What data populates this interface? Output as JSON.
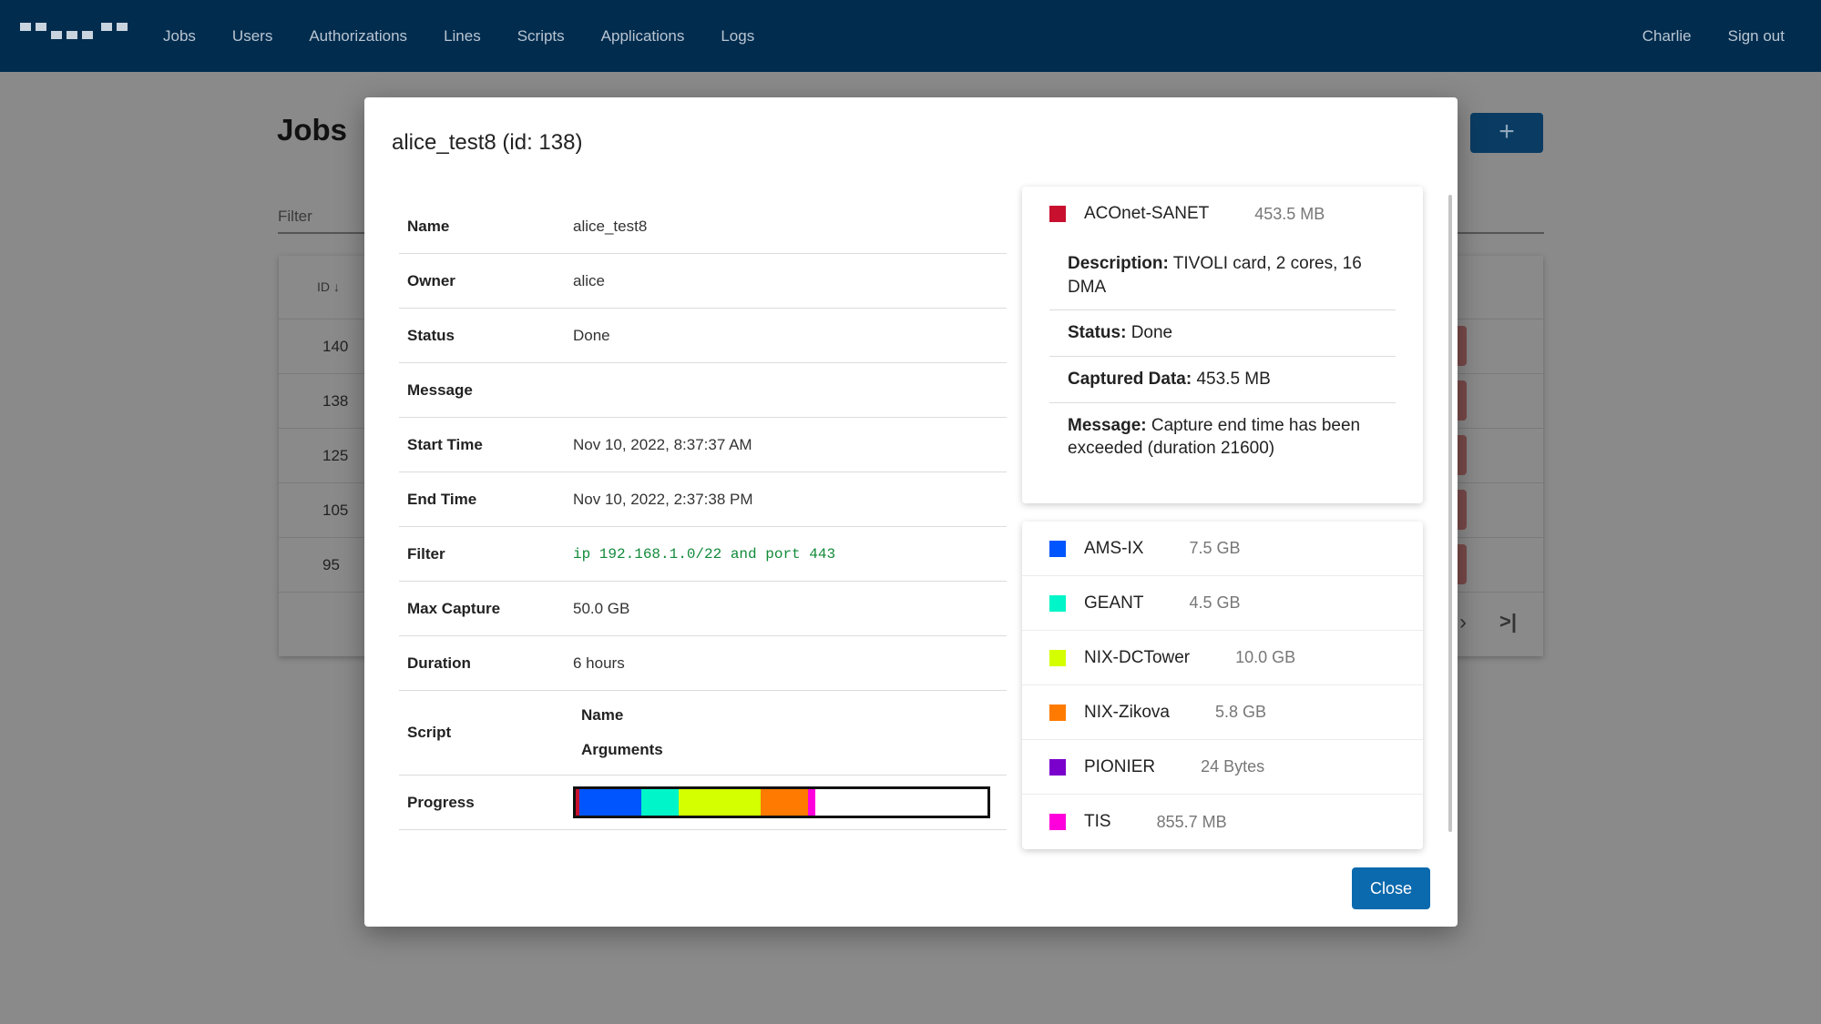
{
  "nav": {
    "items": [
      "Jobs",
      "Users",
      "Authorizations",
      "Lines",
      "Scripts",
      "Applications",
      "Logs"
    ],
    "user": "Charlie",
    "signout": "Sign out"
  },
  "page": {
    "title": "Jobs",
    "add_label": "+",
    "filter_label": "Filter",
    "id_header": "ID ↓",
    "rows": [
      "140",
      "138",
      "125",
      "105",
      "95"
    ]
  },
  "modal": {
    "title": "alice_test8 (id: 138)",
    "details": [
      {
        "key": "Name",
        "value": "alice_test8"
      },
      {
        "key": "Owner",
        "value": "alice"
      },
      {
        "key": "Status",
        "value": "Done"
      },
      {
        "key": "Message",
        "value": ""
      },
      {
        "key": "Start Time",
        "value": "Nov 10, 2022, 8:37:37 AM"
      },
      {
        "key": "End Time",
        "value": "Nov 10, 2022, 2:37:38 PM"
      },
      {
        "key": "Filter",
        "value": "ip 192.168.1.0/22 and port 443"
      },
      {
        "key": "Max Capture",
        "value": "50.0 GB"
      },
      {
        "key": "Duration",
        "value": "6 hours"
      }
    ],
    "script": {
      "label": "Script",
      "sub": [
        "Name",
        "Arguments"
      ]
    },
    "progress": {
      "label": "Progress",
      "segments": [
        {
          "line": "ACOnet-SANET",
          "fraction": 0.009,
          "color": "#c8102e"
        },
        {
          "line": "AMS-IX",
          "fraction": 0.15,
          "color": "#0055ff"
        },
        {
          "line": "GEANT",
          "fraction": 0.09,
          "color": "#00f5c8"
        },
        {
          "line": "NIX-DCTower",
          "fraction": 0.2,
          "color": "#d4ff00"
        },
        {
          "line": "NIX-Zikova",
          "fraction": 0.116,
          "color": "#ff7a00"
        },
        {
          "line": "PIONIER",
          "fraction": 0.0,
          "color": "#7a00cc"
        },
        {
          "line": "TIS",
          "fraction": 0.017,
          "color": "#ff00dd"
        }
      ]
    },
    "expanded_line": {
      "name": "ACOnet-SANET",
      "size": "453.5 MB",
      "color": "#c8102e",
      "description_label": "Description:",
      "description": "TIVOLI card, 2 cores, 16 DMA",
      "status_label": "Status:",
      "status": "Done",
      "captured_label": "Captured Data:",
      "captured": "453.5 MB",
      "message_label": "Message:",
      "message": "Capture end time has been exceeded (duration 21600)"
    },
    "lines": [
      {
        "name": "AMS-IX",
        "size": "7.5 GB",
        "color": "#0055ff"
      },
      {
        "name": "GEANT",
        "size": "4.5 GB",
        "color": "#00f5c8"
      },
      {
        "name": "NIX-DCTower",
        "size": "10.0 GB",
        "color": "#d4ff00"
      },
      {
        "name": "NIX-Zikova",
        "size": "5.8 GB",
        "color": "#ff7a00"
      },
      {
        "name": "PIONIER",
        "size": "24 Bytes",
        "color": "#7a00cc"
      },
      {
        "name": "TIS",
        "size": "855.7 MB",
        "color": "#ff00dd"
      }
    ],
    "close_label": "Close"
  }
}
